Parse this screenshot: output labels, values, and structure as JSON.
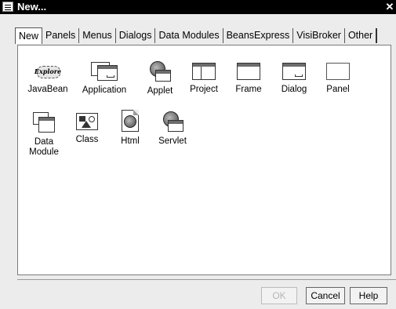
{
  "window": {
    "title": "New...",
    "close_glyph": "✕"
  },
  "tabs": [
    "New",
    "Panels",
    "Menus",
    "Dialogs",
    "Data Modules",
    "BeansExpress",
    "VisiBroker",
    "Other"
  ],
  "active_tab": "New",
  "items": [
    {
      "label": "JavaBean",
      "icon": "javabean-icon",
      "logo_text": "Explore"
    },
    {
      "label": "Application",
      "icon": "application-icon"
    },
    {
      "label": "Applet",
      "icon": "applet-icon"
    },
    {
      "label": "Project",
      "icon": "project-icon"
    },
    {
      "label": "Frame",
      "icon": "frame-icon"
    },
    {
      "label": "Dialog",
      "icon": "dialog-icon"
    },
    {
      "label": "Panel",
      "icon": "panel-icon"
    },
    {
      "label": "Data\nModule",
      "label_line1": "Data",
      "label_line2": "Module",
      "icon": "data-module-icon"
    },
    {
      "label": "Class",
      "icon": "class-icon"
    },
    {
      "label": "Html",
      "icon": "html-icon"
    },
    {
      "label": "Servlet",
      "icon": "servlet-icon"
    }
  ],
  "buttons": {
    "ok": "OK",
    "cancel": "Cancel",
    "help": "Help"
  },
  "ok_disabled": true
}
